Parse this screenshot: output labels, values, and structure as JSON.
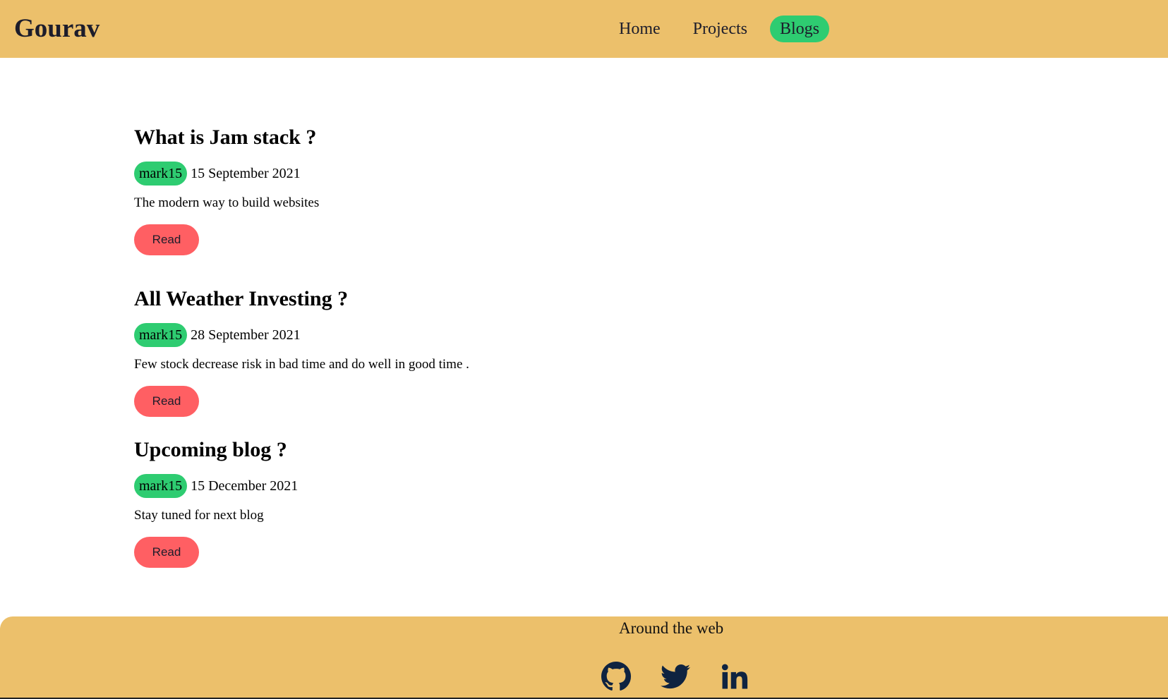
{
  "nav": {
    "brand": "Gourav",
    "links": [
      {
        "label": "Home"
      },
      {
        "label": "Projects"
      },
      {
        "label": "Blogs",
        "active": true
      }
    ]
  },
  "posts": [
    {
      "title": "What is Jam stack ?",
      "author": "mark15",
      "date": "15 September 2021",
      "description": "The modern way to build websites",
      "button": "Read"
    },
    {
      "title": "All Weather Investing ?",
      "author": "mark15",
      "date": "28 September 2021",
      "description": "Few stock decrease risk in bad time and do well in good time .",
      "button": "Read"
    },
    {
      "title": "Upcoming blog ?",
      "author": "mark15",
      "date": "15 December 2021",
      "description": "Stay tuned for next blog",
      "button": "Read"
    }
  ],
  "footer": {
    "title": "Around the web",
    "socials": [
      {
        "icon": "github-icon"
      },
      {
        "icon": "twitter-icon"
      },
      {
        "icon": "linkedin-icon"
      }
    ]
  },
  "colors": {
    "header_bg": "#ECC06B",
    "accent_green": "#2ECC71",
    "button_red": "#FF5F63",
    "icon_dark": "#0F2340"
  }
}
